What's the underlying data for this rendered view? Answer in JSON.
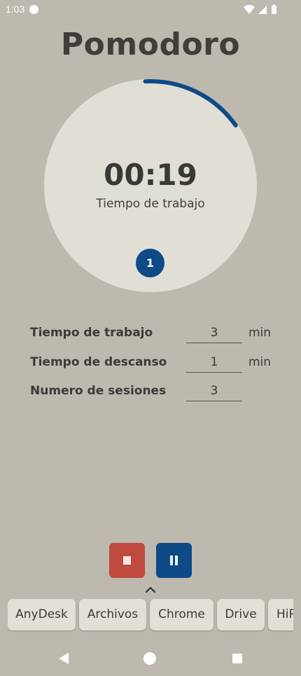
{
  "status_bar": {
    "time": "1:03"
  },
  "app": {
    "title": "Pomodoro"
  },
  "timer": {
    "time_remaining": "00:19",
    "mode_label": "Tiempo de trabajo",
    "current_session": "1",
    "progress_fraction": 0.16,
    "progress_color": "#0d4a86"
  },
  "settings": {
    "work": {
      "label": "Tiempo de trabajo",
      "value": "3",
      "unit": "min"
    },
    "break": {
      "label": "Tiempo de descanso",
      "value": "1",
      "unit": "min"
    },
    "sessions": {
      "label": "Numero de sesiones",
      "value": "3"
    }
  },
  "controls": {
    "stop_color": "#bf4a3d",
    "pause_color": "#0d4a86"
  },
  "dock": {
    "apps": [
      "AnyDesk",
      "Archivos",
      "Chrome",
      "Drive",
      "HiP"
    ]
  },
  "icons": {
    "status_dot": "notification-dot-icon",
    "wifi": "wifi-icon",
    "signal": "signal-icon",
    "battery": "battery-icon",
    "stop": "stop-icon",
    "pause": "pause-icon",
    "chevron": "chevron-up-icon",
    "nav_back": "back-icon",
    "nav_home": "home-icon",
    "nav_recents": "recents-icon"
  }
}
